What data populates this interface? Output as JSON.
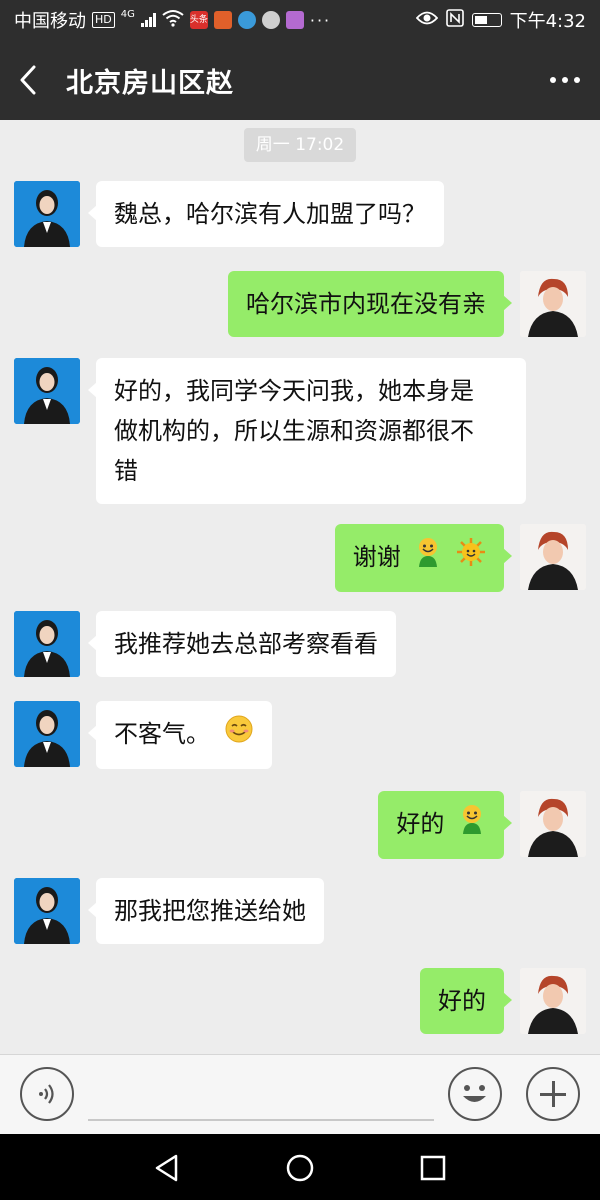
{
  "status_bar": {
    "carrier": "中国移动",
    "hd_badge": "HD",
    "network": "4G",
    "app_badge": "头条",
    "time": "下午4:32",
    "icons": [
      "wifi-icon",
      "eye-icon",
      "nfc-icon",
      "battery-icon"
    ]
  },
  "header": {
    "title": "北京房山区赵",
    "back_icon": "back-arrow-icon",
    "more_icon": "more-dots-icon"
  },
  "chat": {
    "timestamp": "周一 17:02",
    "messages": [
      {
        "side": "left",
        "text": "魏总，哈尔滨有人加盟了吗？"
      },
      {
        "side": "right",
        "text": "哈尔滨市内现在没有亲"
      },
      {
        "side": "left",
        "line1": "好的，我同学今天问我，她本身是",
        "line2": "做机构的，所以生源和资源都很不",
        "line3": "错"
      },
      {
        "side": "right",
        "text": "谢谢",
        "emojis": [
          "grin-emoji-icon",
          "sun-emoji-icon"
        ]
      },
      {
        "side": "left",
        "text": "我推荐她去总部考察看看"
      },
      {
        "side": "left",
        "text": "不客气。",
        "emojis": [
          "smile-emoji-icon"
        ]
      },
      {
        "side": "right",
        "text": "好的",
        "emojis": [
          "grin-emoji-icon"
        ]
      },
      {
        "side": "left",
        "text": "那我把您推送给她"
      },
      {
        "side": "right",
        "text": "好的"
      }
    ]
  },
  "input_bar": {
    "voice_icon": "voice-icon",
    "text_value": "",
    "emoji_icon": "emoji-icon",
    "plus_icon": "plus-icon"
  },
  "nav_bar": {
    "icons": [
      "nav-back-icon",
      "nav-home-icon",
      "nav-recents-icon"
    ]
  },
  "colors": {
    "header_bg": "#2e2e2e",
    "chat_bg": "#ededed",
    "outgoing_bubble": "#95ec69",
    "incoming_bubble": "#ffffff"
  }
}
